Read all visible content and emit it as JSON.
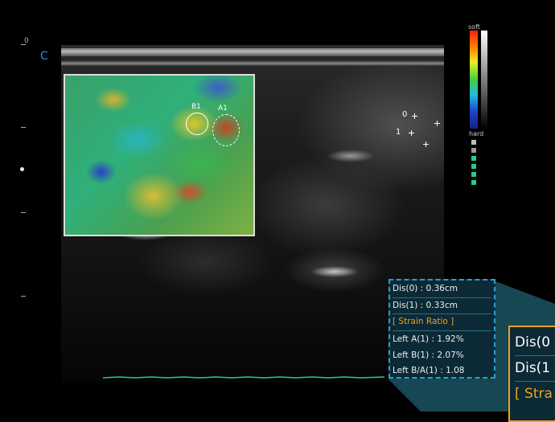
{
  "screen": {
    "depth_zero_label": "0",
    "mode_marker": "C"
  },
  "color_scale": {
    "top_label": "soft",
    "bottom_label": "hard",
    "colors": [
      "#ee2211",
      "#ff8800",
      "#eeee22",
      "#44cc44",
      "#22bbdd",
      "#2244cc",
      "#112288"
    ]
  },
  "elastography": {
    "roi_a_label": "A1",
    "roi_b_label": "B1"
  },
  "calipers": {
    "marker_0": "0",
    "marker_1": "1"
  },
  "measurements": {
    "rows": [
      "Dis(0) : 0.36cm",
      "Dis(1) : 0.33cm",
      "[ Strain Ratio ]",
      "Left   A(1) : 1.92%",
      "Left   B(1) : 2.07%",
      "Left   B/A(1) : 1.08"
    ]
  },
  "zoom_callout": {
    "rows": [
      "Dis(0",
      "Dis(1",
      "[ Stra"
    ]
  }
}
